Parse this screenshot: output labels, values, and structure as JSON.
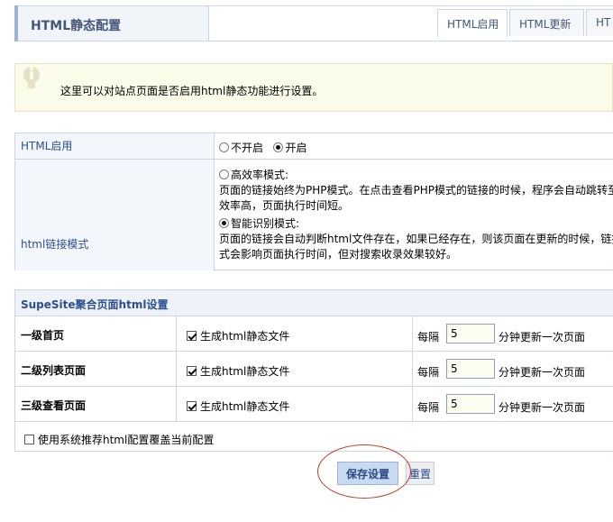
{
  "header": {
    "title": "HTML静态配置",
    "tabs": [
      {
        "label": "HTML启用",
        "active": true
      },
      {
        "label": "HTML更新",
        "active": false
      },
      {
        "label": "HT",
        "active": false
      }
    ]
  },
  "tip": {
    "text": "这里可以对站点页面是否启用html静态功能进行设置。"
  },
  "html_enable": {
    "label": "HTML启用",
    "options": [
      "不开启",
      "开启"
    ],
    "selected": "开启"
  },
  "link_mode": {
    "label": "html链接模式",
    "option1_title": "高效率模式:",
    "option1_desc_line1": "页面的链接始终为PHP模式。在点击查看PHP模式的链接的时候，程序会自动跳转至",
    "option1_desc_line2": "效率高，页面执行时间短。",
    "option2_title": "智能识别模式:",
    "option2_desc_line1": "页面的链接会自动判断html文件存在，如果已经存在，则该页面在更新的时候，链接",
    "option2_desc_line2": "式会影响页面执行时间，但对搜索收录效果较好。",
    "selected": "智能识别模式:"
  },
  "aggregate": {
    "header": "SupeSite聚合页面html设置",
    "rows": [
      {
        "name": "一级首页",
        "generate_label": "生成html静态文件",
        "checked": true,
        "interval_prefix": "每隔",
        "interval": "5",
        "interval_suffix": "分钟更新一次页面"
      },
      {
        "name": "二级列表页面",
        "generate_label": "生成html静态文件",
        "checked": true,
        "interval_prefix": "每隔",
        "interval": "5",
        "interval_suffix": "分钟更新一次页面"
      },
      {
        "name": "三级查看页面",
        "generate_label": "生成html静态文件",
        "checked": true,
        "interval_prefix": "每隔",
        "interval": "5",
        "interval_suffix": "分钟更新一次页面"
      }
    ],
    "override_label": "使用系统推荐html配置覆盖当前配置",
    "override_checked": false
  },
  "buttons": {
    "save": "保存设置",
    "reset": "重置"
  },
  "colors": {
    "accent": "#43577a",
    "link_blue": "#2a4e8f",
    "highlight_ring": "#c0392b",
    "tip_bg": "#fbfbe9"
  }
}
